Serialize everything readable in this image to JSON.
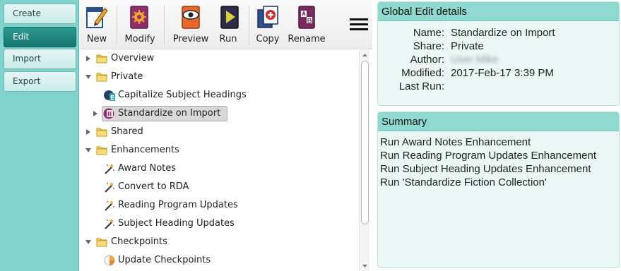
{
  "nav": {
    "items": [
      {
        "label": "Create",
        "active": false
      },
      {
        "label": "Edit",
        "active": true
      },
      {
        "label": "Import",
        "active": false
      },
      {
        "label": "Export",
        "active": false
      }
    ]
  },
  "toolbar": {
    "new": "New",
    "modify": "Modify",
    "preview": "Preview",
    "run": "Run",
    "copy": "Copy",
    "rename": "Rename"
  },
  "tree": {
    "rows": [
      {
        "label": "Overview",
        "icon": "folder-icon",
        "expand": "collapsed"
      },
      {
        "label": "Private",
        "icon": "folder-icon",
        "expand": "expanded"
      },
      {
        "label": "Capitalize Subject Headings",
        "icon": "edit-item-icon",
        "expand": "none"
      },
      {
        "label": "Standardize on Import",
        "icon": "import-item-icon",
        "expand": "collapsed",
        "selected": true
      },
      {
        "label": "Shared",
        "icon": "folder-icon",
        "expand": "collapsed"
      },
      {
        "label": "Enhancements",
        "icon": "folder-icon",
        "expand": "expanded"
      },
      {
        "label": "Award Notes",
        "icon": "magic-wand-icon",
        "expand": "none"
      },
      {
        "label": "Convert to RDA",
        "icon": "magic-wand-icon",
        "expand": "none"
      },
      {
        "label": "Reading Program Updates",
        "icon": "magic-wand-icon",
        "expand": "none"
      },
      {
        "label": "Subject Heading Updates",
        "icon": "magic-wand-icon",
        "expand": "none"
      },
      {
        "label": "Checkpoints",
        "icon": "folder-icon",
        "expand": "expanded"
      },
      {
        "label": "Update Checkpoints",
        "icon": "checkpoint-icon",
        "expand": "none"
      }
    ]
  },
  "details": {
    "title": "Global Edit details",
    "name_key": "Name:",
    "name_val": "Standardize on Import",
    "share_key": "Share:",
    "share_val": "Private",
    "author_key": "Author:",
    "author_val": "User Mike",
    "modified_key": "Modified:",
    "modified_val": "2017-Feb-17 3:39 PM",
    "lastrun_key": "Last Run:",
    "lastrun_val": ""
  },
  "summary": {
    "title": "Summary",
    "lines": [
      "Run Award Notes Enhancement",
      "Run Reading Program Updates Enhancement",
      "Run Subject Heading Updates Enhancement",
      "Run 'Standardize Fiction Collection'"
    ]
  },
  "colors": {
    "nav_bg": "#7fd3cc",
    "nav_active": "#17766f",
    "panel_head": "#8fd9d1",
    "panel_bg": "#eaf7f5",
    "folder": "#f2c94c"
  }
}
